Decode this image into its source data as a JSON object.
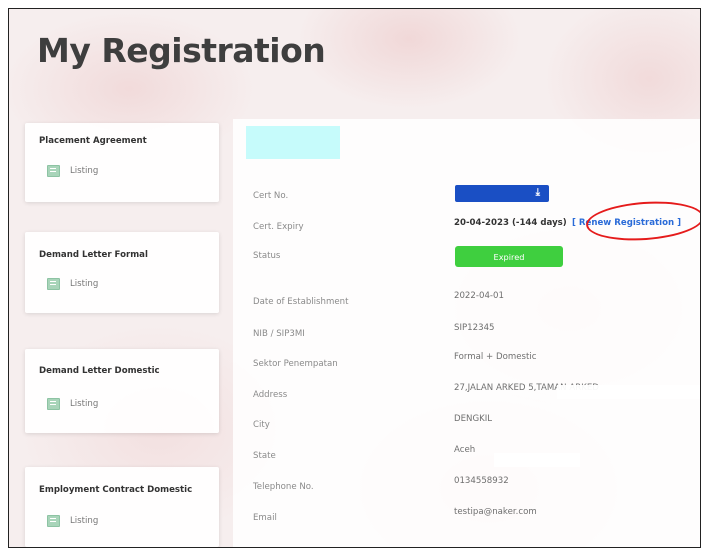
{
  "page": {
    "title": "My Registration"
  },
  "sidebar": {
    "cards": [
      {
        "title": "Placement Agreement",
        "link_label": "Listing"
      },
      {
        "title": "Demand Letter Formal",
        "link_label": "Listing"
      },
      {
        "title": "Demand Letter Domestic",
        "link_label": "Listing"
      },
      {
        "title": "Employment Contract Domestic",
        "link_label": "Listing"
      }
    ]
  },
  "details": {
    "labels": {
      "cert_no": "Cert No.",
      "cert_expiry": "Cert. Expiry",
      "status": "Status",
      "date_of_establishment": "Date of Establishment",
      "nib": "NIB / SIP3MI",
      "sektor": "Sektor Penempatan",
      "address": "Address",
      "city": "City",
      "state": "State",
      "telephone": "Telephone No.",
      "email": "Email"
    },
    "values": {
      "cert_download_icon": "download-icon",
      "cert_expiry": "20-04-2023 (-144 days)",
      "renew_link": "[ Renew Registration ]",
      "status": "Expired",
      "date_of_establishment": "2022-04-01",
      "nib": "SIP12345",
      "sektor": "Formal + Domestic",
      "address": "27,JALAN ARKED 5,TAMAN ARKED",
      "city": "DENGKIL",
      "state": "Aceh",
      "telephone": "0134558932",
      "email": "testipa@naker.com"
    }
  },
  "colors": {
    "cert_button": "#1a4fc4",
    "status_badge": "#3fcf3f",
    "renew_link": "#2a6bd8",
    "annotation_oval": "#e51b1b",
    "redaction_block": "#c6fbfb"
  }
}
